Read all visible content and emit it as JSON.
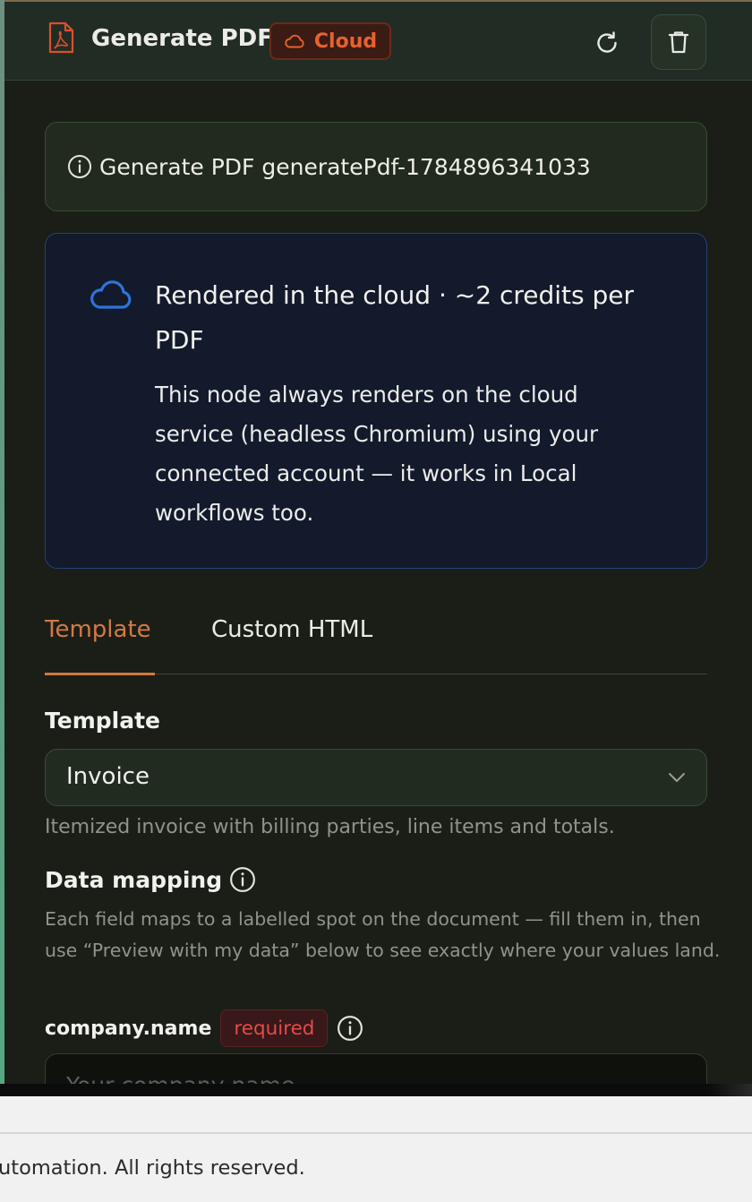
{
  "colors": {
    "panel_bg": "#1b1e17",
    "accent_orange": "#d17a47",
    "cloud_blue": "#2f73da",
    "required_red": "#e44b4b"
  },
  "header": {
    "icon": "pdf-file-icon",
    "title": "Generate PDF",
    "badge_icon": "cloud-icon",
    "badge_label": "Cloud",
    "refresh_icon": "refresh-icon",
    "delete_icon": "trash-icon"
  },
  "info": {
    "icon": "info-icon",
    "text": "Generate PDF generatePdf-1784896341033"
  },
  "cloud_notice": {
    "icon": "cloud-icon",
    "title": "Rendered in the cloud · ~2 credits per PDF",
    "description": "This node always renders on the cloud service (headless Chromium) using your connected account — it works in Local workflows too."
  },
  "tabs": [
    {
      "label": "Template",
      "active": true
    },
    {
      "label": "Custom HTML",
      "active": false
    }
  ],
  "template_section": {
    "label": "Template",
    "selected": "Invoice",
    "hint": "Itemized invoice with billing parties, line items and totals."
  },
  "data_mapping": {
    "title": "Data mapping",
    "description": "Each field maps to a labelled spot on the document — fill them in, then use “Preview with my data” below to see exactly where your values land."
  },
  "fields": [
    {
      "name": "company.name",
      "badge": "required",
      "placeholder": "Your company name"
    }
  ],
  "footer": {
    "text": "utomation. All rights reserved."
  }
}
